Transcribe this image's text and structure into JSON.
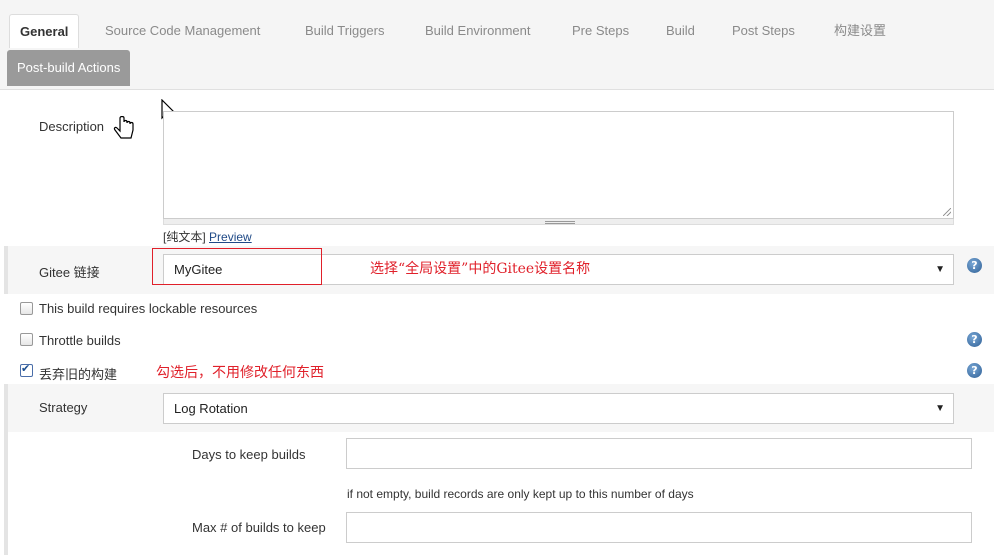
{
  "tabs": [
    {
      "label": "General",
      "active": true
    },
    {
      "label": "Source Code Management"
    },
    {
      "label": "Build Triggers"
    },
    {
      "label": "Build Environment"
    },
    {
      "label": "Pre Steps"
    },
    {
      "label": "Build"
    },
    {
      "label": "Post Steps"
    },
    {
      "label": "构建设置"
    },
    {
      "label": "Post-build Actions"
    }
  ],
  "description": {
    "label": "Description",
    "value": "",
    "format_prefix": "[纯文本]",
    "preview_link": "Preview"
  },
  "gitee": {
    "label": "Gitee 链接",
    "selected": "MyGitee",
    "annotation": "选择“全局设置”中的Gitee设置名称"
  },
  "options": {
    "lockable": {
      "label": "This build requires lockable resources",
      "checked": false
    },
    "throttle": {
      "label": "Throttle builds",
      "checked": false
    },
    "discard": {
      "label": "丢弃旧的构建",
      "checked": true,
      "annotation": "勾选后，不用修改任何东西"
    }
  },
  "strategy": {
    "label": "Strategy",
    "selected": "Log Rotation",
    "days_label": "Days to keep builds",
    "days_value": "",
    "days_hint": "if not empty, build records are only kept up to this number of days",
    "max_label": "Max # of builds to keep",
    "max_value": ""
  },
  "icons": {
    "help": "help-icon",
    "caret": "dropdown-caret-icon"
  },
  "colors": {
    "annotation": "#e0202a",
    "link": "#204a87",
    "help": "#2e5f95"
  }
}
